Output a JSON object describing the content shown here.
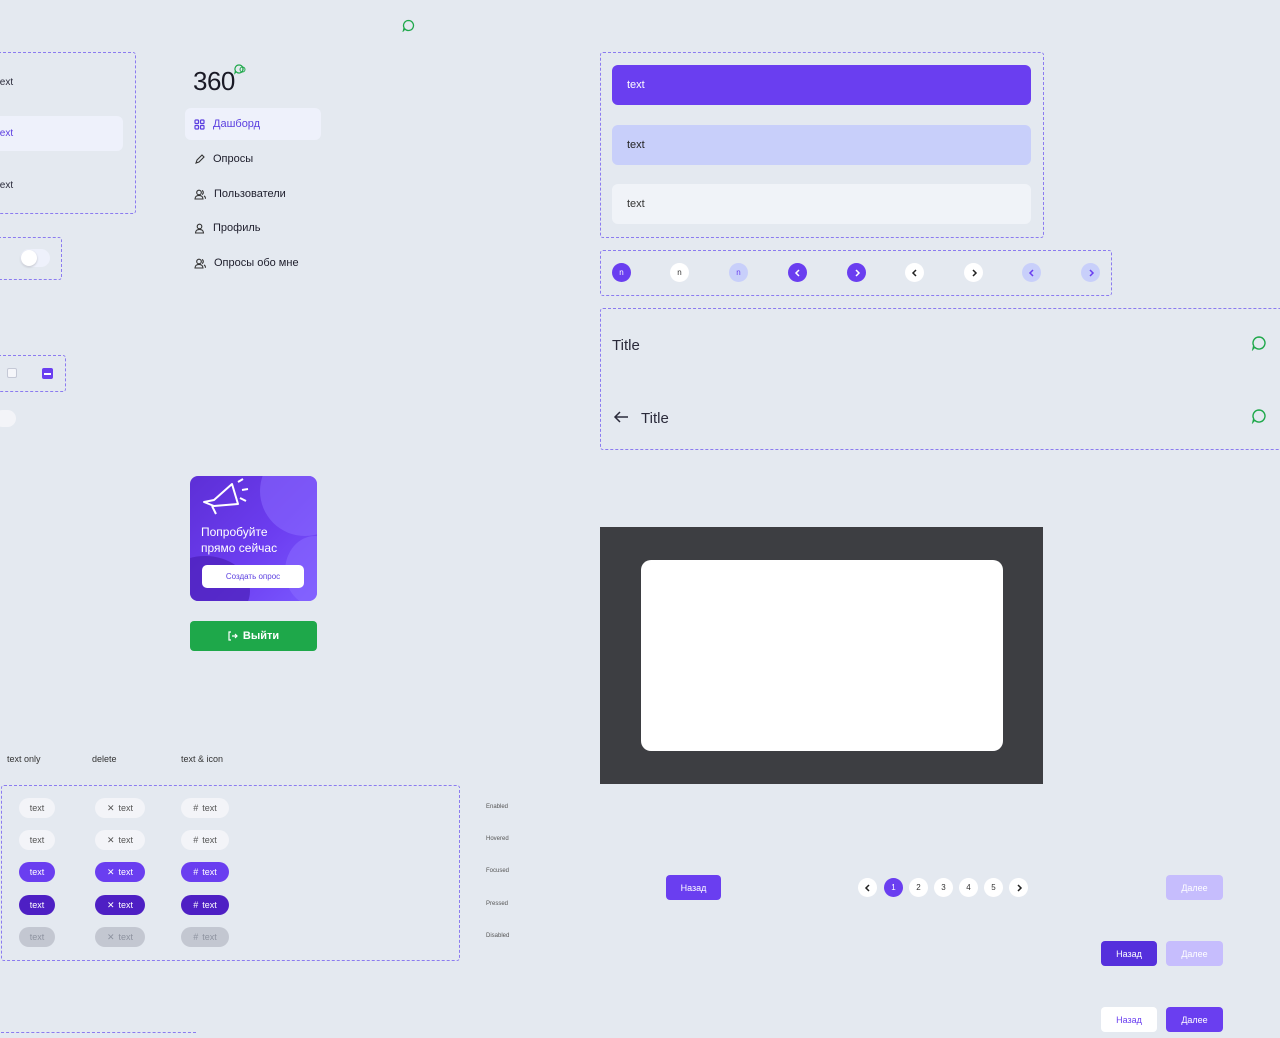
{
  "left_list": {
    "items": [
      "text",
      "text",
      "text"
    ]
  },
  "chips_section": {
    "columns": [
      "text only",
      "delete",
      "text & icon"
    ],
    "states": [
      "Enabled",
      "Hovered",
      "Focused",
      "Pressed",
      "Disabled"
    ],
    "chip_label": "text"
  },
  "sidebar": {
    "logo": "360",
    "items": [
      {
        "label": "Дашборд",
        "icon": "grid-icon"
      },
      {
        "label": "Опросы",
        "icon": "pencil-icon"
      },
      {
        "label": "Пользователи",
        "icon": "users-icon"
      },
      {
        "label": "Профиль",
        "icon": "user-icon"
      },
      {
        "label": "Опросы обо мне",
        "icon": "users-icon"
      }
    ]
  },
  "promo": {
    "text": "Попробуйте прямо сейчас",
    "button": "Создать опрос"
  },
  "logout": {
    "label": "Выйти"
  },
  "options": [
    {
      "label": "text"
    },
    {
      "label": "text"
    },
    {
      "label": "text"
    }
  ],
  "circle_buttons": {
    "label": "n"
  },
  "titles": [
    {
      "label": "Title"
    },
    {
      "label": "Title"
    }
  ],
  "pagination": {
    "back": "Назад",
    "next": "Далее",
    "pages": [
      "1",
      "2",
      "3",
      "4",
      "5"
    ],
    "current": "1"
  },
  "colors": {
    "accent": "#6a3ef0",
    "success": "#1ea84a",
    "bg": "#e4e9f0"
  }
}
